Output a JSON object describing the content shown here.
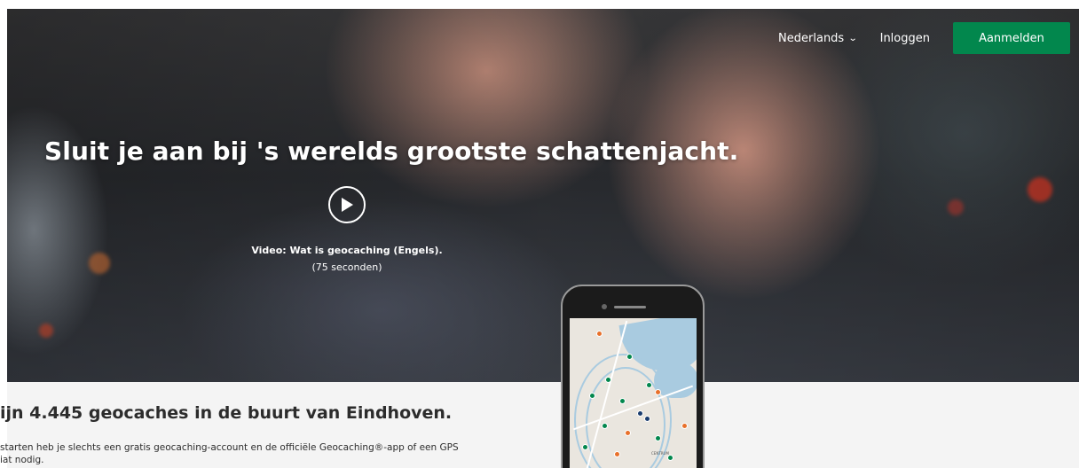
{
  "nav": {
    "language": "Nederlands",
    "login": "Inloggen",
    "signup": "Aanmelden",
    "accent_color": "#02874d"
  },
  "hero": {
    "title": "Sluit je aan bij 's werelds grootste schattenjacht.",
    "play_icon": "play-icon",
    "video_title": "Video: Wat is geocaching (Engels).",
    "video_duration": "(75 seconden)"
  },
  "lower": {
    "headline": "ijn 4.445 geocaches in de buurt van Eindhoven.",
    "description_line1": "starten heb je slechts een gratis geocaching-account en de officiële Geocaching®-app of een GPS",
    "description_line2": "iat nodig."
  },
  "phone_map": {
    "label_centrum": "CENTRUM"
  }
}
